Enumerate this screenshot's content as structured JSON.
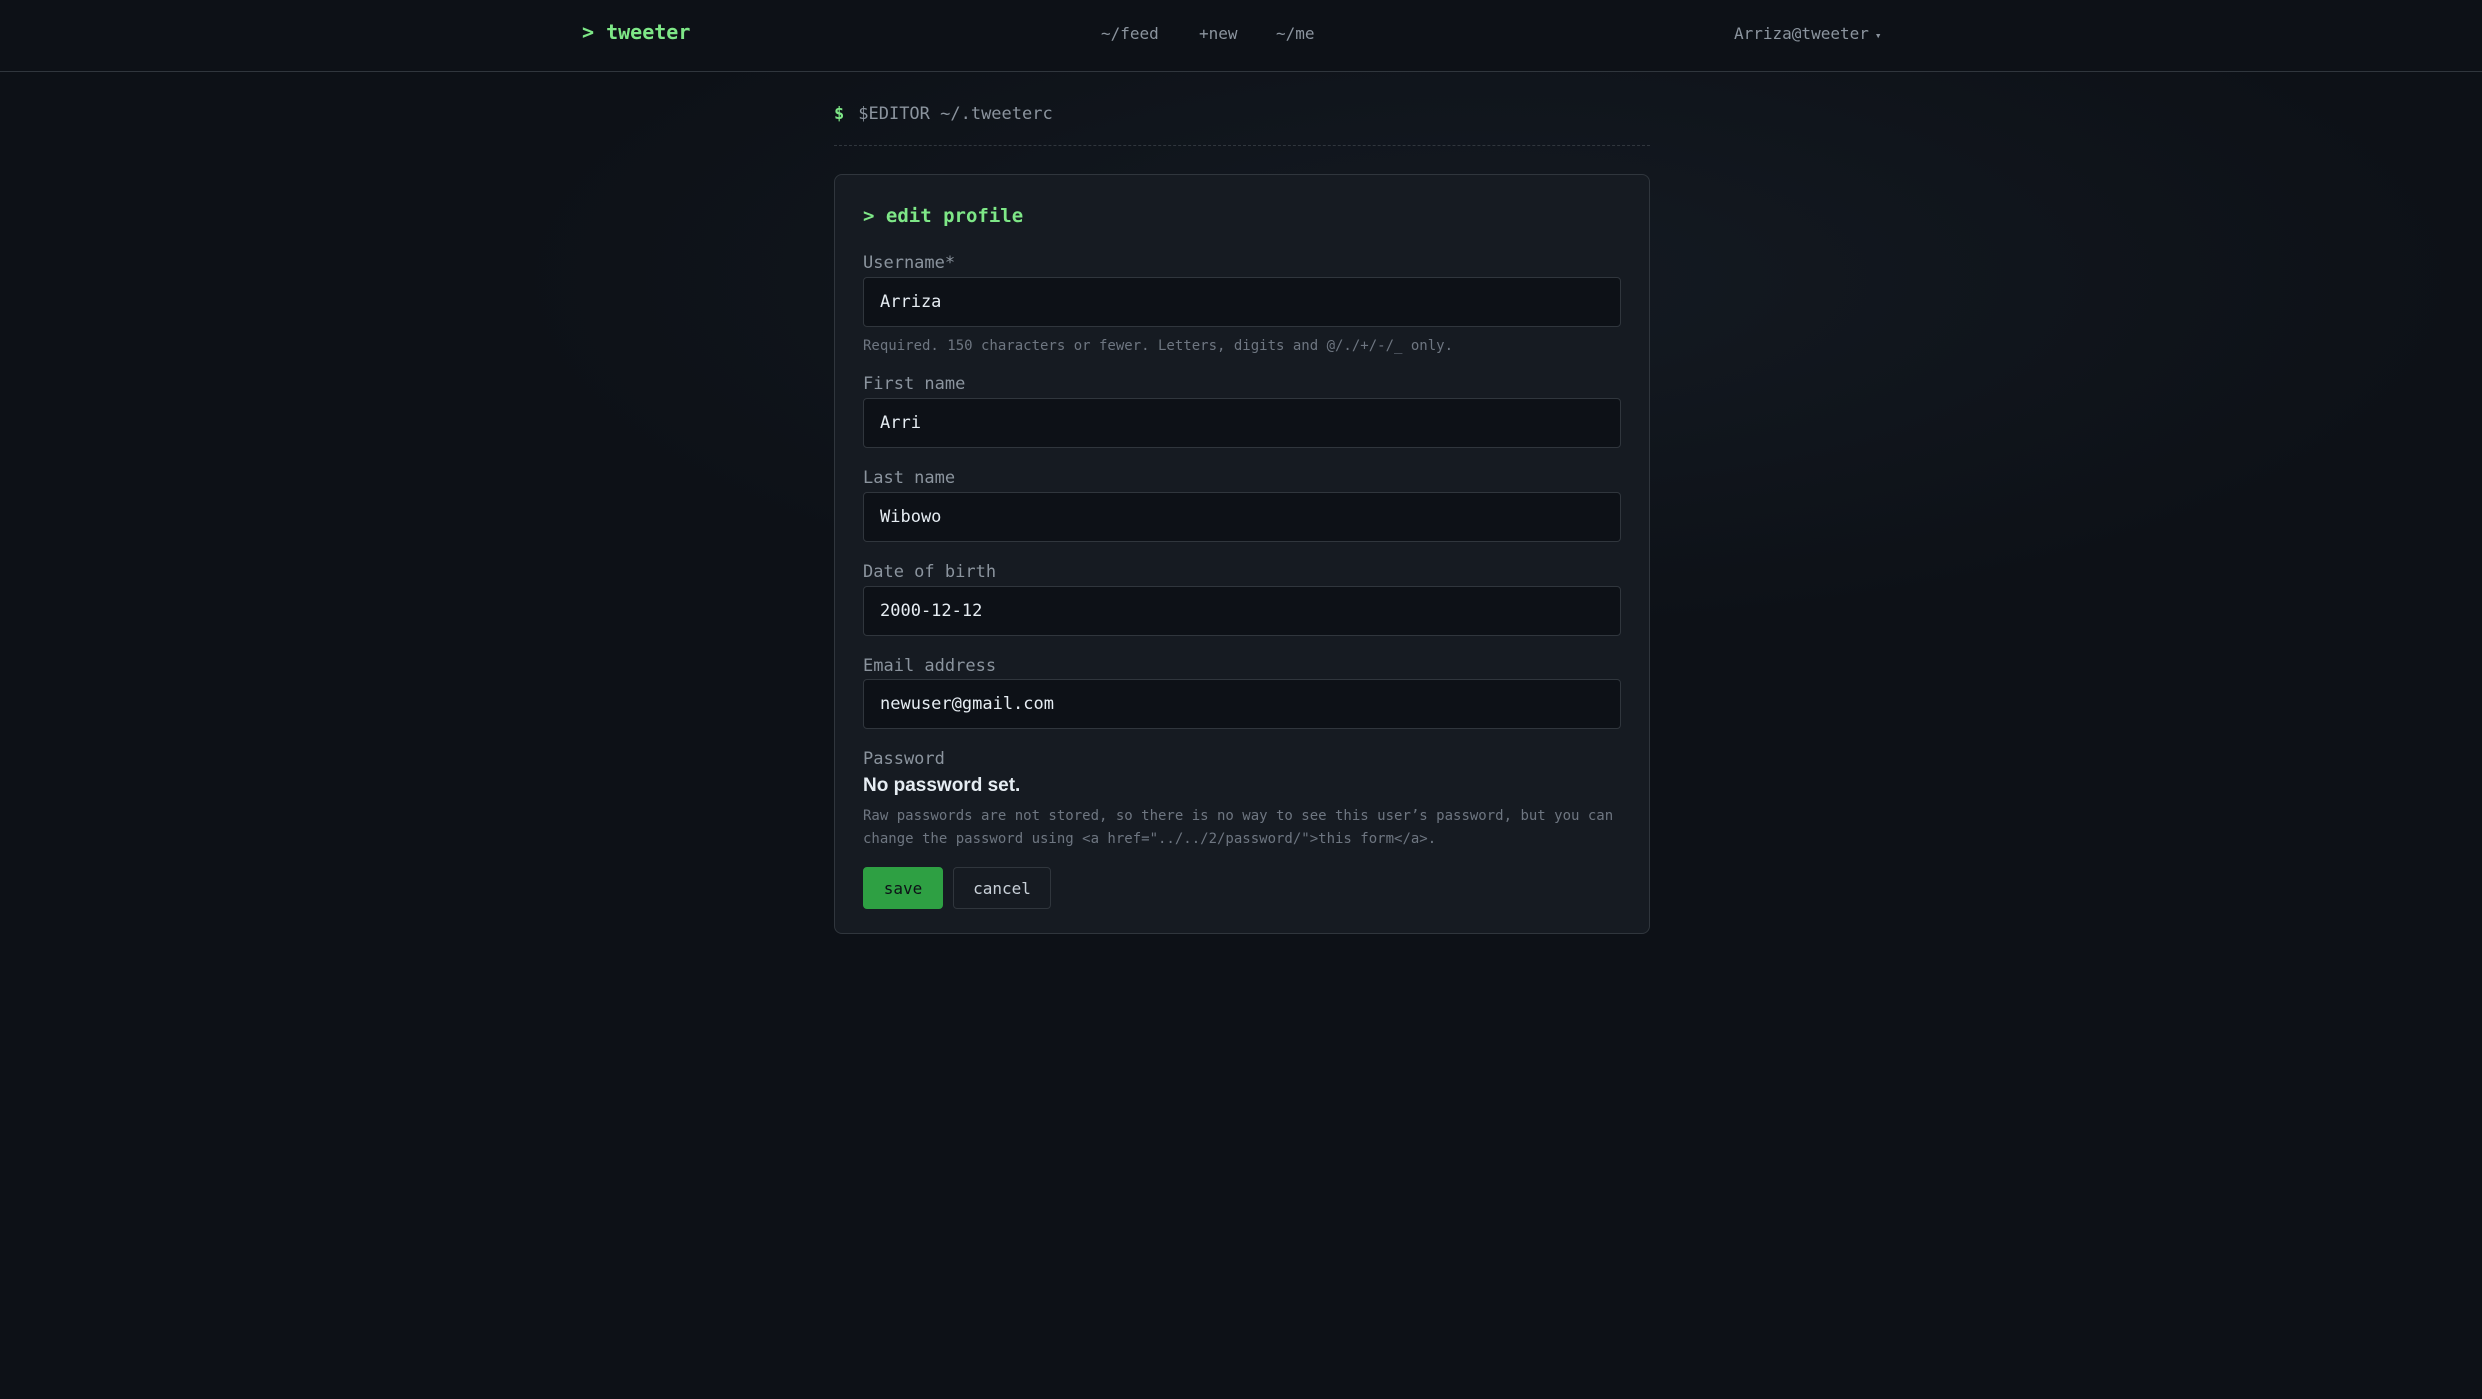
{
  "header": {
    "brand": "> tweeter",
    "nav": [
      {
        "label": "~/feed"
      },
      {
        "label": "+new"
      },
      {
        "label": "~/me"
      }
    ],
    "user_menu": {
      "label": "Arriza@tweeter",
      "caret": "▾"
    }
  },
  "prompt": {
    "symbol": "$",
    "command": "$EDITOR ~/.tweeterc"
  },
  "form": {
    "title": "> edit profile",
    "fields": [
      {
        "label": "Username*",
        "value": "Arriza",
        "help": "Required. 150 characters or fewer. Letters, digits and @/./+/-/_ only."
      },
      {
        "label": "First name",
        "value": "Arri"
      },
      {
        "label": "Last name",
        "value": "Wibowo"
      },
      {
        "label": "Date of birth",
        "value": "2000-12-12"
      },
      {
        "label": "Email address",
        "value": "newuser@gmail.com"
      }
    ],
    "password": {
      "label": "Password",
      "status": "No password set.",
      "help": "Raw passwords are not stored, so there is no way to see this user’s password, but you can change the password using <a href=\"../../2/password/\">this form</a>."
    },
    "save_label": "save",
    "cancel_label": "cancel"
  },
  "colors": {
    "accent": "#7ee787",
    "save_button": "#2ea043",
    "background": "#0d1117",
    "card": "#161b22"
  }
}
